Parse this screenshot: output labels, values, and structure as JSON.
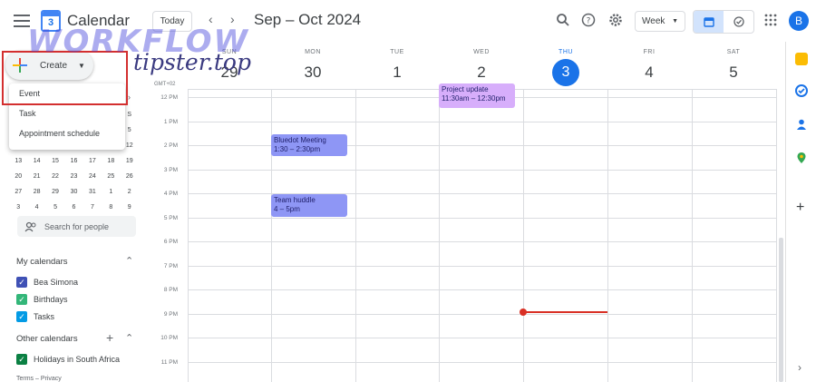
{
  "header": {
    "app_title": "Calendar",
    "logo_number": "3",
    "today_label": "Today",
    "prev_arrow": "‹",
    "next_arrow": "›",
    "date_range": "Sep – Oct 2024",
    "view_label": "Week",
    "avatar_letter": "B"
  },
  "watermark": {
    "line1": "WORKFLOW",
    "line2": "tipster.top"
  },
  "create": {
    "label": "Create",
    "menu": [
      "Event",
      "Task",
      "Appointment schedule"
    ]
  },
  "mini_calendar": {
    "rows": [
      [
        "",
        "",
        "",
        "",
        "",
        "",
        "S"
      ],
      [
        "",
        "",
        "",
        "",
        "",
        "",
        "5"
      ],
      [
        "",
        "",
        "",
        "",
        "",
        "",
        "12"
      ],
      [
        "13",
        "14",
        "15",
        "16",
        "17",
        "18",
        "19"
      ],
      [
        "20",
        "21",
        "22",
        "23",
        "24",
        "25",
        "26"
      ],
      [
        "27",
        "28",
        "29",
        "30",
        "31",
        "1",
        "2"
      ],
      [
        "3",
        "4",
        "5",
        "6",
        "7",
        "8",
        "9"
      ]
    ]
  },
  "search_people": "Search for people",
  "my_calendars": {
    "title": "My calendars",
    "items": [
      {
        "label": "Bea Simona",
        "color": "#3f51b5"
      },
      {
        "label": "Birthdays",
        "color": "#33b679"
      },
      {
        "label": "Tasks",
        "color": "#039be5"
      }
    ]
  },
  "other_calendars": {
    "title": "Other calendars",
    "items": [
      {
        "label": "Holidays in South Africa",
        "color": "#0b8043"
      }
    ]
  },
  "terms": "Terms – Privacy",
  "week": {
    "timezone": "GMT+02",
    "days": [
      {
        "name": "SUN",
        "num": "29"
      },
      {
        "name": "MON",
        "num": "30"
      },
      {
        "name": "TUE",
        "num": "1"
      },
      {
        "name": "WED",
        "num": "2"
      },
      {
        "name": "THU",
        "num": "3"
      },
      {
        "name": "FRI",
        "num": "4"
      },
      {
        "name": "SAT",
        "num": "5"
      }
    ],
    "hours": [
      "12 PM",
      "1 PM",
      "2 PM",
      "3 PM",
      "4 PM",
      "5 PM",
      "6 PM",
      "7 PM",
      "8 PM",
      "9 PM",
      "10 PM",
      "11 PM"
    ]
  },
  "events": [
    {
      "title": "Project update",
      "time": "11:30am – 12:30pm",
      "color": "#d7aefb"
    },
    {
      "title": "Bluedot Meeting",
      "time": "1:30 – 2:30pm",
      "color": "#8e96f5"
    },
    {
      "title": "Team huddle",
      "time": "4 – 5pm",
      "color": "#8e96f5"
    }
  ],
  "colors": {
    "accent": "#1a73e8",
    "now_line": "#d93025",
    "highlight_box": "#d32f2f"
  }
}
